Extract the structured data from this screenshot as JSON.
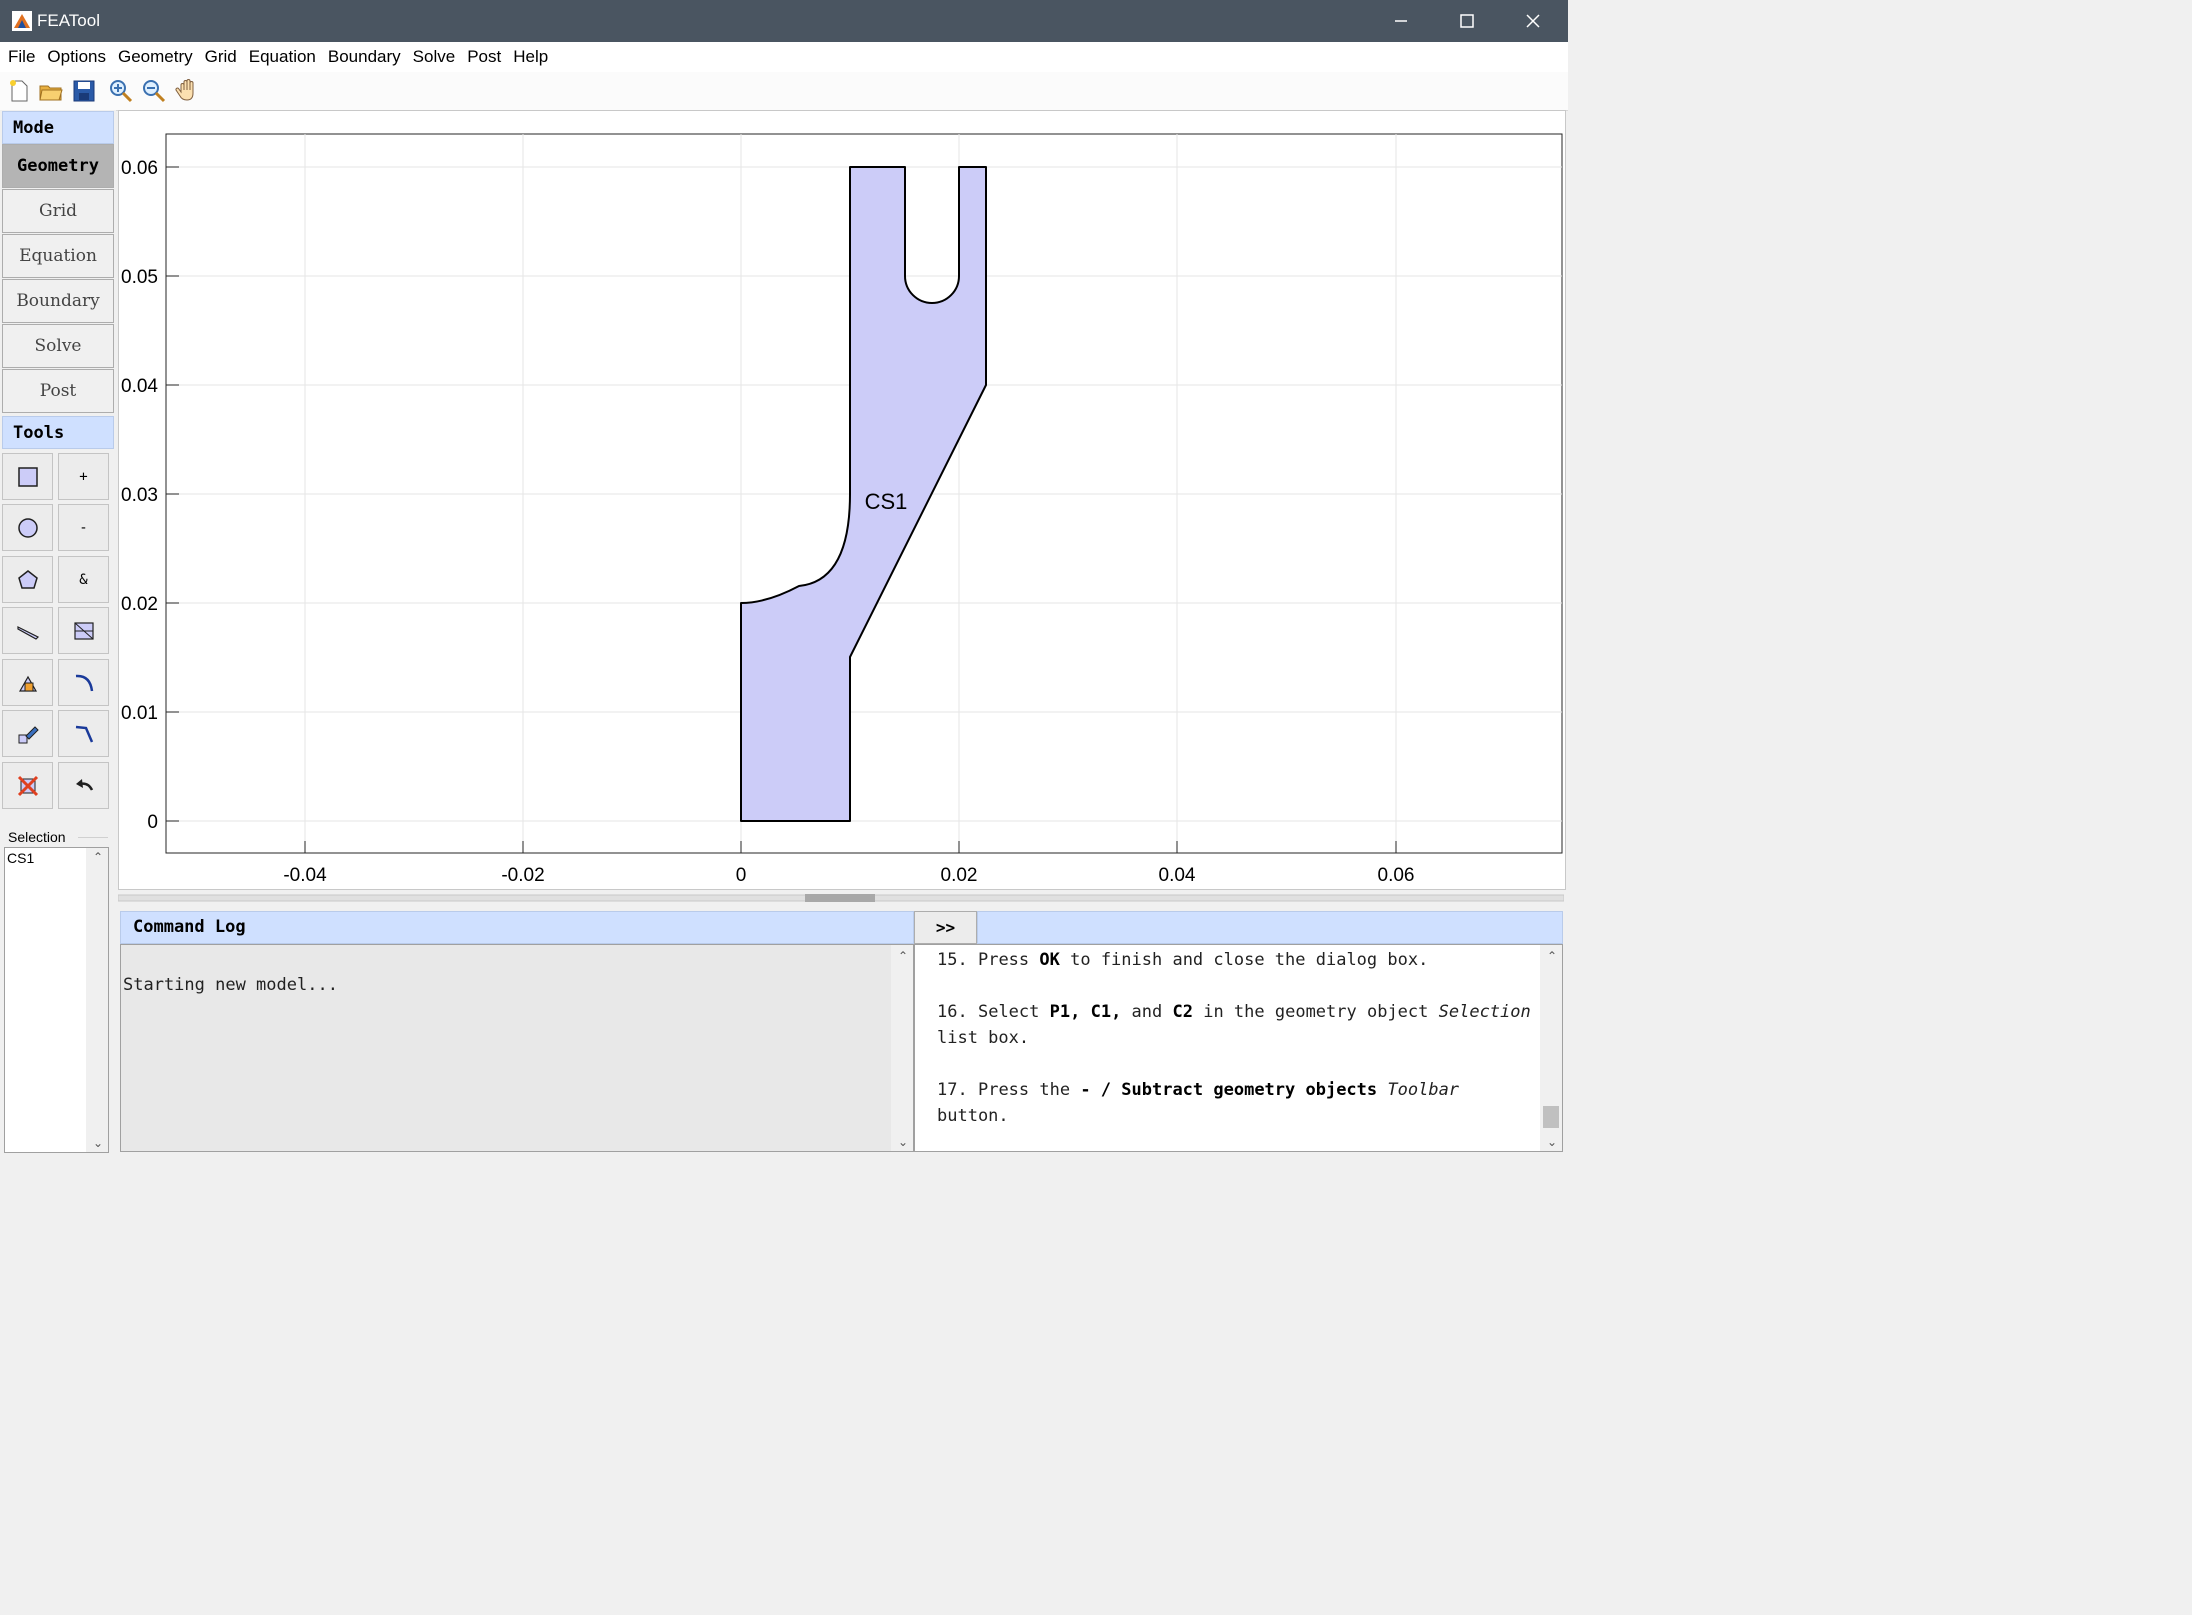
{
  "window": {
    "title": "FEATool"
  },
  "menu": [
    "File",
    "Options",
    "Geometry",
    "Grid",
    "Equation",
    "Boundary",
    "Solve",
    "Post",
    "Help"
  ],
  "toolbar_icons": [
    "new-file-icon",
    "open-folder-icon",
    "save-icon",
    "zoom-in-icon",
    "zoom-out-icon",
    "pan-hand-icon"
  ],
  "mode": {
    "header": "Mode",
    "buttons": [
      "Geometry",
      "Grid",
      "Equation",
      "Boundary",
      "Solve",
      "Post"
    ],
    "active": "Geometry"
  },
  "tools": {
    "header": "Tools",
    "buttons": [
      {
        "name": "rectangle-icon",
        "label": ""
      },
      {
        "name": "union-button",
        "label": "+"
      },
      {
        "name": "circle-icon",
        "label": ""
      },
      {
        "name": "subtract-button",
        "label": "-"
      },
      {
        "name": "polygon-icon",
        "label": ""
      },
      {
        "name": "intersect-button",
        "label": "&"
      },
      {
        "name": "line-icon",
        "label": ""
      },
      {
        "name": "grid-select-icon",
        "label": ""
      },
      {
        "name": "transform-icon",
        "label": ""
      },
      {
        "name": "fillet-icon",
        "label": ""
      },
      {
        "name": "edit-icon",
        "label": ""
      },
      {
        "name": "chamfer-icon",
        "label": ""
      },
      {
        "name": "delete-icon",
        "label": ""
      },
      {
        "name": "undo-icon",
        "label": ""
      }
    ]
  },
  "selection": {
    "label": "Selection",
    "items": [
      "CS1"
    ]
  },
  "plot": {
    "x_ticks": [
      "-0.04",
      "-0.02",
      "0",
      "0.02",
      "0.04",
      "0.06"
    ],
    "y_ticks": [
      "0",
      "0.01",
      "0.02",
      "0.03",
      "0.04",
      "0.05",
      "0.06"
    ],
    "object_label": "CS1",
    "fill_color": "#ccccf8"
  },
  "command_log": {
    "header": "Command Log",
    "toggle": ">>",
    "text": "Starting new model..."
  },
  "help": {
    "step15": {
      "num": "15.",
      "a": "Press ",
      "b": "OK",
      "c": " to finish and close the dialog box."
    },
    "step16": {
      "num": "16.",
      "a": "Select ",
      "b": "P1,",
      "c": " ",
      "d": "C1,",
      "e": " and ",
      "f": "C2",
      "g": " in the geometry object ",
      "h": "Selection",
      "i": " list box."
    },
    "step17": {
      "num": "17.",
      "a": "Press the ",
      "b": "- / Subtract geometry objects",
      "c": " ",
      "d": "Toolbar",
      "e": " button."
    }
  }
}
